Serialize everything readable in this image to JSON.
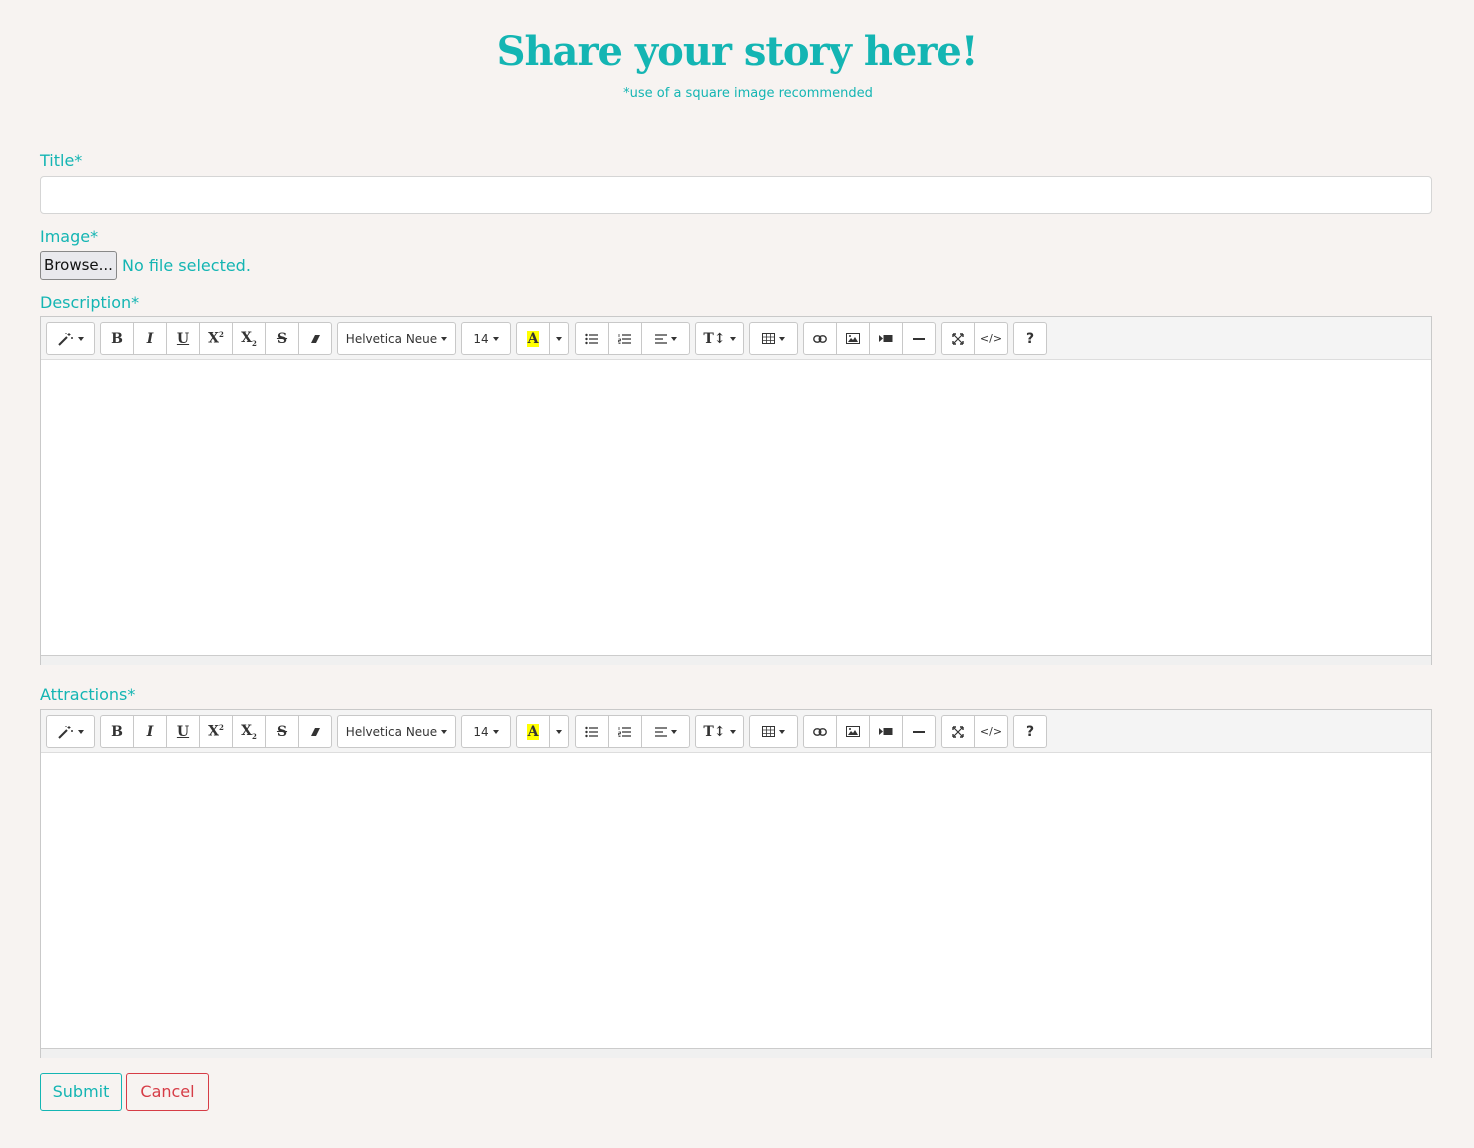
{
  "header": {
    "title": "Share your story here!",
    "subtitle": "*use of a square image recommended"
  },
  "form": {
    "title_label": "Title*",
    "title_value": "",
    "image_label": "Image*",
    "browse_label": "Browse...",
    "no_file_text": "No file selected.",
    "description_label": "Description*",
    "attractions_label": "Attractions*",
    "submit_label": "Submit",
    "cancel_label": "Cancel"
  },
  "toolbar": {
    "font_name": "Helvetica Neue",
    "font_size": "14",
    "help_label": "?",
    "icons": [
      "magic-icon",
      "bold-icon",
      "italic-icon",
      "underline-icon",
      "superscript-icon",
      "subscript-icon",
      "strikethrough-icon",
      "eraser-icon",
      "font-color-icon",
      "unordered-list-icon",
      "ordered-list-icon",
      "align-icon",
      "line-height-icon",
      "table-icon",
      "link-icon",
      "picture-icon",
      "video-icon",
      "horizontal-rule-icon",
      "fullscreen-icon",
      "code-view-icon"
    ]
  },
  "colors": {
    "accent": "#14b5b3",
    "cancel": "#d63c46",
    "background": "#f7f3f1"
  }
}
